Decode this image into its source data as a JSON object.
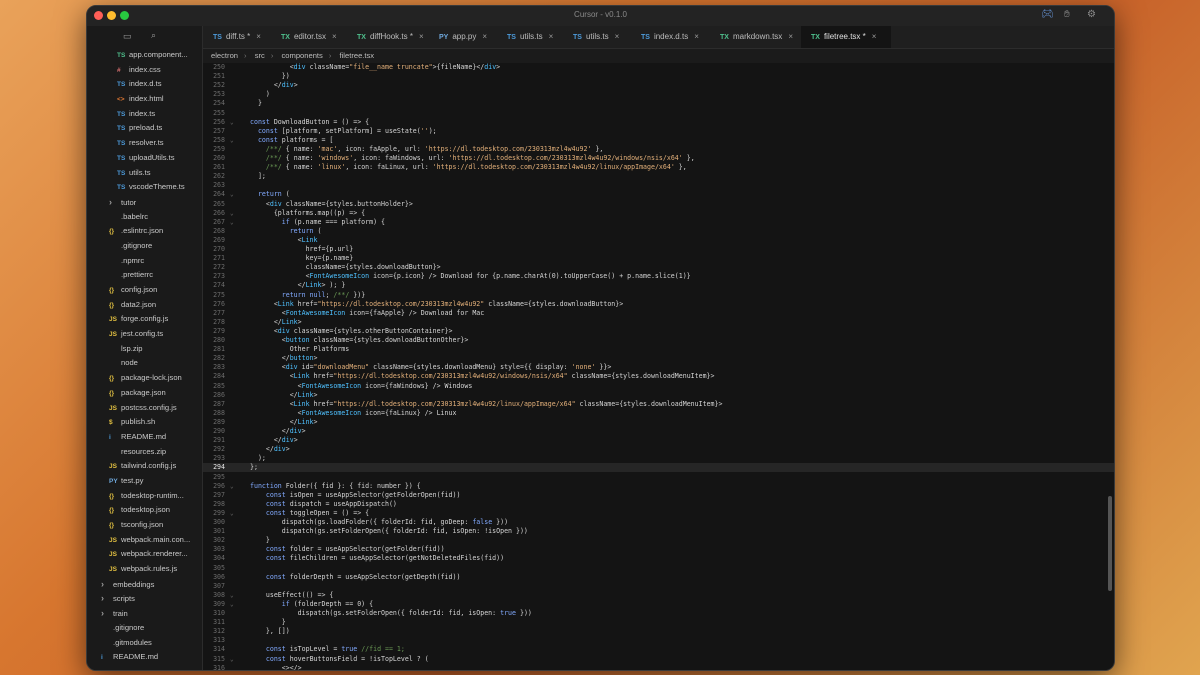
{
  "window": {
    "title": "Cursor - v0.1.0"
  },
  "colors": {
    "ts": "#4d9bdb",
    "tsx": "#4fc08d",
    "css": "#d66f6f",
    "html": "#e37933",
    "json": "#e2c041",
    "py": "#6fa8dc",
    "folder": "#9a9a9a"
  },
  "sidebar": {
    "items": [
      {
        "icon": "TS",
        "label": "app.component...",
        "kind": "tsx",
        "depth": 2
      },
      {
        "icon": "#",
        "label": "index.css",
        "kind": "css",
        "depth": 2
      },
      {
        "icon": "TS",
        "label": "index.d.ts",
        "kind": "ts",
        "depth": 2
      },
      {
        "icon": "<>",
        "label": "index.html",
        "kind": "html",
        "depth": 2
      },
      {
        "icon": "TS",
        "label": "index.ts",
        "kind": "ts",
        "depth": 2
      },
      {
        "icon": "TS",
        "label": "preload.ts",
        "kind": "ts",
        "depth": 2
      },
      {
        "icon": "TS",
        "label": "resolver.ts",
        "kind": "ts",
        "depth": 2
      },
      {
        "icon": "TS",
        "label": "uploadUtils.ts",
        "kind": "ts",
        "depth": 2
      },
      {
        "icon": "TS",
        "label": "utils.ts",
        "kind": "ts",
        "depth": 2
      },
      {
        "icon": "TS",
        "label": "vscodeTheme.ts",
        "kind": "ts",
        "depth": 2
      },
      {
        "icon": "›",
        "label": "tutor",
        "kind": "folder",
        "depth": 1
      },
      {
        "icon": "",
        "label": ".babelrc",
        "kind": "plain",
        "depth": 1
      },
      {
        "icon": "{}",
        "label": ".eslintrc.json",
        "kind": "json",
        "depth": 1
      },
      {
        "icon": "",
        "label": ".gitignore",
        "kind": "plain",
        "depth": 1
      },
      {
        "icon": "",
        "label": ".npmrc",
        "kind": "plain",
        "depth": 1
      },
      {
        "icon": "",
        "label": ".prettierrc",
        "kind": "plain",
        "depth": 1
      },
      {
        "icon": "{}",
        "label": "config.json",
        "kind": "json",
        "depth": 1
      },
      {
        "icon": "{}",
        "label": "data2.json",
        "kind": "json",
        "depth": 1
      },
      {
        "icon": "JS",
        "label": "forge.config.js",
        "kind": "json",
        "depth": 1
      },
      {
        "icon": "JS",
        "label": "jest.config.ts",
        "kind": "json",
        "depth": 1
      },
      {
        "icon": "",
        "label": "lsp.zip",
        "kind": "plain",
        "depth": 1
      },
      {
        "icon": "",
        "label": "node",
        "kind": "plain",
        "depth": 1
      },
      {
        "icon": "{}",
        "label": "package-lock.json",
        "kind": "json",
        "depth": 1
      },
      {
        "icon": "{}",
        "label": "package.json",
        "kind": "json",
        "depth": 1
      },
      {
        "icon": "JS",
        "label": "postcss.config.js",
        "kind": "json",
        "depth": 1
      },
      {
        "icon": "$",
        "label": "publish.sh",
        "kind": "json",
        "depth": 1
      },
      {
        "icon": "i",
        "label": "README.md",
        "kind": "ts",
        "depth": 1
      },
      {
        "icon": "",
        "label": "resources.zip",
        "kind": "plain",
        "depth": 1
      },
      {
        "icon": "JS",
        "label": "tailwind.config.js",
        "kind": "json",
        "depth": 1
      },
      {
        "icon": "PY",
        "label": "test.py",
        "kind": "py",
        "depth": 1
      },
      {
        "icon": "{}",
        "label": "todesktop-runtim...",
        "kind": "json",
        "depth": 1
      },
      {
        "icon": "{}",
        "label": "todesktop.json",
        "kind": "json",
        "depth": 1
      },
      {
        "icon": "{}",
        "label": "tsconfig.json",
        "kind": "json",
        "depth": 1
      },
      {
        "icon": "JS",
        "label": "webpack.main.con...",
        "kind": "json",
        "depth": 1
      },
      {
        "icon": "JS",
        "label": "webpack.renderer...",
        "kind": "json",
        "depth": 1
      },
      {
        "icon": "JS",
        "label": "webpack.rules.js",
        "kind": "json",
        "depth": 1
      },
      {
        "icon": "›",
        "label": "embeddings",
        "kind": "folder",
        "depth": 0
      },
      {
        "icon": "›",
        "label": "scripts",
        "kind": "folder",
        "depth": 0
      },
      {
        "icon": "›",
        "label": "train",
        "kind": "folder",
        "depth": 0
      },
      {
        "icon": "",
        "label": ".gitignore",
        "kind": "plain",
        "depth": 0
      },
      {
        "icon": "",
        "label": ".gitmodules",
        "kind": "plain",
        "depth": 0
      },
      {
        "icon": "i",
        "label": "README.md",
        "kind": "ts",
        "depth": 0
      }
    ]
  },
  "tabs": [
    {
      "icon": "TS",
      "label": "diff.ts *",
      "kind": "ts"
    },
    {
      "icon": "TX",
      "label": "editor.tsx",
      "kind": "tsx"
    },
    {
      "icon": "TX",
      "label": "diffHook.ts *",
      "kind": "tsx"
    },
    {
      "icon": "PY",
      "label": "app.py",
      "kind": "py"
    },
    {
      "icon": "TS",
      "label": "utils.ts",
      "kind": "ts"
    },
    {
      "icon": "TS",
      "label": "utils.ts",
      "kind": "ts"
    },
    {
      "icon": "TS",
      "label": "index.d.ts",
      "kind": "ts"
    },
    {
      "icon": "TX",
      "label": "markdown.tsx",
      "kind": "tsx"
    },
    {
      "icon": "TX",
      "label": "filetree.tsx *",
      "kind": "tsx",
      "active": true
    }
  ],
  "breadcrumb": [
    "electron",
    "src",
    "components",
    "filetree.tsx"
  ],
  "editor": {
    "current_line": "294",
    "lines": [
      {
        "n": "250",
        "t": "          <div className=\"file__name truncate\">{fileName}</div>"
      },
      {
        "n": "251",
        "t": "        })"
      },
      {
        "n": "252",
        "t": "      </div>"
      },
      {
        "n": "253",
        "t": "    )"
      },
      {
        "n": "254",
        "t": "  }"
      },
      {
        "n": "255",
        "t": ""
      },
      {
        "n": "256",
        "t": "const DownloadButton = () => {",
        "fold": true
      },
      {
        "n": "257",
        "t": "  const [platform, setPlatform] = useState('');"
      },
      {
        "n": "258",
        "t": "  const platforms = [",
        "fold": true
      },
      {
        "n": "259",
        "t": "    /**/ { name: 'mac', icon: faApple, url: 'https://dl.todesktop.com/230313mzl4w4u92' },"
      },
      {
        "n": "260",
        "t": "    /**/ { name: 'windows', icon: faWindows, url: 'https://dl.todesktop.com/230313mzl4w4u92/windows/nsis/x64' },"
      },
      {
        "n": "261",
        "t": "    /**/ { name: 'linux', icon: faLinux, url: 'https://dl.todesktop.com/230313mzl4w4u92/linux/appImage/x64' },"
      },
      {
        "n": "262",
        "t": "  ];"
      },
      {
        "n": "263",
        "t": ""
      },
      {
        "n": "264",
        "t": "  return (",
        "fold": true
      },
      {
        "n": "265",
        "t": "    <div className={styles.buttonHolder}>"
      },
      {
        "n": "266",
        "t": "      {platforms.map((p) => {",
        "fold": true
      },
      {
        "n": "267",
        "t": "        if (p.name === platform) {",
        "fold": true
      },
      {
        "n": "268",
        "t": "          return ("
      },
      {
        "n": "269",
        "t": "            <Link"
      },
      {
        "n": "270",
        "t": "              href={p.url}"
      },
      {
        "n": "271",
        "t": "              key={p.name}"
      },
      {
        "n": "272",
        "t": "              className={styles.downloadButton}>"
      },
      {
        "n": "273",
        "t": "              <FontAwesomeIcon icon={p.icon} /> Download for {p.name.charAt(0).toUpperCase() + p.name.slice(1)}"
      },
      {
        "n": "274",
        "t": "            </Link> ); }"
      },
      {
        "n": "275",
        "t": "        return null; /**/ })}"
      },
      {
        "n": "276",
        "t": "      <Link href=\"https://dl.todesktop.com/230313mzl4w4u92\" className={styles.downloadButton}>"
      },
      {
        "n": "277",
        "t": "        <FontAwesomeIcon icon={faApple} /> Download for Mac"
      },
      {
        "n": "278",
        "t": "      </Link>"
      },
      {
        "n": "279",
        "t": "      <div className={styles.otherButtonContainer}>"
      },
      {
        "n": "280",
        "t": "        <button className={styles.downloadButtonOther}>"
      },
      {
        "n": "281",
        "t": "          Other Platforms"
      },
      {
        "n": "282",
        "t": "        </button>"
      },
      {
        "n": "283",
        "t": "        <div id=\"downloadMenu\" className={styles.downloadMenu} style={{ display: 'none' }}>"
      },
      {
        "n": "284",
        "t": "          <Link href=\"https://dl.todesktop.com/230313mzl4w4u92/windows/nsis/x64\" className={styles.downloadMenuItem}>"
      },
      {
        "n": "285",
        "t": "            <FontAwesomeIcon icon={faWindows} /> Windows"
      },
      {
        "n": "286",
        "t": "          </Link>"
      },
      {
        "n": "287",
        "t": "          <Link href=\"https://dl.todesktop.com/230313mzl4w4u92/linux/appImage/x64\" className={styles.downloadMenuItem}>"
      },
      {
        "n": "288",
        "t": "            <FontAwesomeIcon icon={faLinux} /> Linux"
      },
      {
        "n": "289",
        "t": "          </Link>"
      },
      {
        "n": "290",
        "t": "        </div>"
      },
      {
        "n": "291",
        "t": "      </div>"
      },
      {
        "n": "292",
        "t": "    </div>"
      },
      {
        "n": "293",
        "t": "  );"
      },
      {
        "n": "294",
        "t": "};"
      },
      {
        "n": "295",
        "t": ""
      },
      {
        "n": "296",
        "t": "function Folder({ fid }: { fid: number }) {",
        "fold": true
      },
      {
        "n": "297",
        "t": "    const isOpen = useAppSelector(getFolderOpen(fid))"
      },
      {
        "n": "298",
        "t": "    const dispatch = useAppDispatch()"
      },
      {
        "n": "299",
        "t": "    const toggleOpen = () => {",
        "fold": true
      },
      {
        "n": "300",
        "t": "        dispatch(gs.loadFolder({ folderId: fid, goDeep: false }))"
      },
      {
        "n": "301",
        "t": "        dispatch(gs.setFolderOpen({ folderId: fid, isOpen: !isOpen }))"
      },
      {
        "n": "302",
        "t": "    }"
      },
      {
        "n": "303",
        "t": "    const folder = useAppSelector(getFolder(fid))"
      },
      {
        "n": "304",
        "t": "    const fileChildren = useAppSelector(getNotDeletedFiles(fid))"
      },
      {
        "n": "305",
        "t": ""
      },
      {
        "n": "306",
        "t": "    const folderDepth = useAppSelector(getDepth(fid))"
      },
      {
        "n": "307",
        "t": ""
      },
      {
        "n": "308",
        "t": "    useEffect(() => {",
        "fold": true
      },
      {
        "n": "309",
        "t": "        if (folderDepth == 0) {",
        "fold": true
      },
      {
        "n": "310",
        "t": "            dispatch(gs.setFolderOpen({ folderId: fid, isOpen: true }))"
      },
      {
        "n": "311",
        "t": "        }"
      },
      {
        "n": "312",
        "t": "    }, [])"
      },
      {
        "n": "313",
        "t": ""
      },
      {
        "n": "314",
        "t": "    const isTopLevel = true //fid == 1;"
      },
      {
        "n": "315",
        "t": "    const hoverButtonsField = !isTopLevel ? (",
        "fold": true
      },
      {
        "n": "316",
        "t": "        <></>"
      },
      {
        "n": "317",
        "t": "    ) : ("
      }
    ]
  }
}
